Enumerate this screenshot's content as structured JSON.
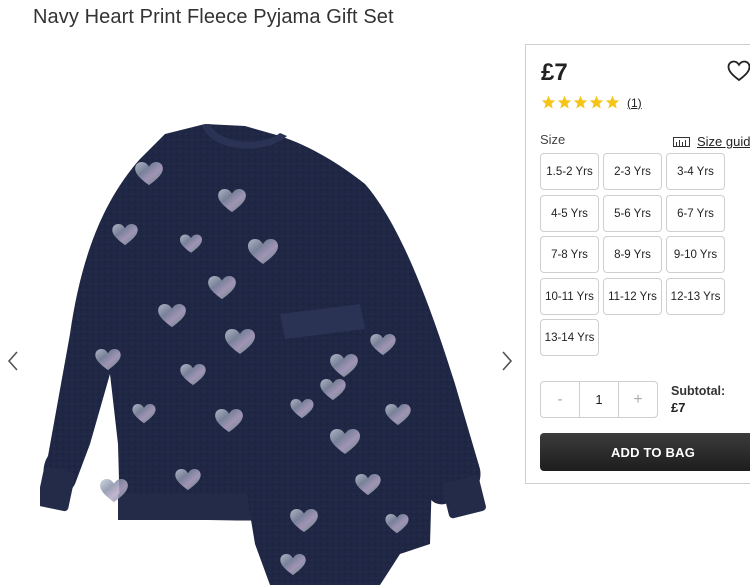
{
  "product": {
    "title": "Navy Heart Print Fleece Pyjama Gift Set",
    "price": "£7",
    "rating": 5,
    "review_count": "(1)"
  },
  "sizes": {
    "label": "Size",
    "guide_label": "Size guide",
    "options": [
      "1.5-2 Yrs",
      "2-3 Yrs",
      "3-4 Yrs",
      "4-5 Yrs",
      "5-6 Yrs",
      "6-7 Yrs",
      "7-8 Yrs",
      "8-9 Yrs",
      "9-10 Yrs",
      "10-11 Yrs",
      "11-12 Yrs",
      "12-13 Yrs",
      "13-14 Yrs"
    ]
  },
  "quantity": {
    "minus": "-",
    "value": "1",
    "plus": "+"
  },
  "subtotal": {
    "label": "Subtotal:",
    "value": "£7"
  },
  "add_to_bag": "ADD TO BAG",
  "icons": {
    "wishlist": "heart-outline-icon",
    "star": "star-icon",
    "ruler": "ruler-icon",
    "prev": "chevron-left-icon",
    "next": "chevron-right-icon"
  },
  "colors": {
    "star": "#f5c518",
    "garment": "#1d2440",
    "button": "#222222"
  }
}
